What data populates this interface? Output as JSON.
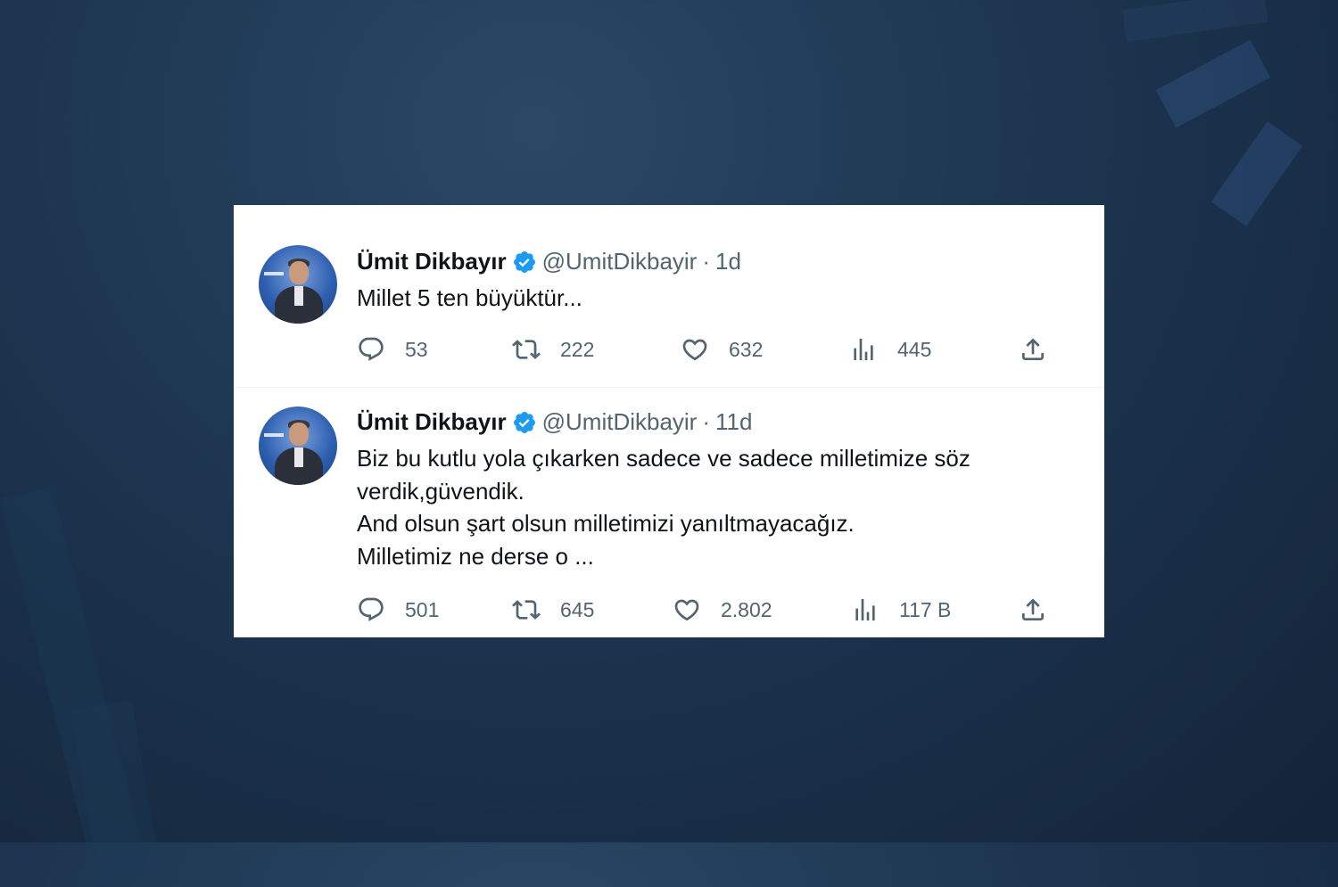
{
  "tweets": [
    {
      "name": "Ümit Dikbayır",
      "handle": "@UmitDikbayir",
      "separator": "·",
      "time": "1d",
      "lines": [
        "Millet 5 ten büyüktür..."
      ],
      "replies": "53",
      "retweets": "222",
      "likes": "632",
      "views": "445"
    },
    {
      "name": "Ümit Dikbayır",
      "handle": "@UmitDikbayir",
      "separator": "·",
      "time": "11d",
      "lines": [
        "Biz bu kutlu yola çıkarken sadece ve sadece milletimize söz",
        "verdik,güvendik.",
        "And olsun şart olsun milletimizi yanıltmayacağız.",
        "Milletimiz ne derse o ..."
      ],
      "replies": "501",
      "retweets": "645",
      "likes": "2.802",
      "views": "117 B"
    }
  ],
  "icons": {
    "verified": "verified-badge-icon",
    "reply": "reply-icon",
    "retweet": "retweet-icon",
    "like": "heart-icon",
    "views": "views-icon",
    "share": "share-icon"
  },
  "colors": {
    "verified": "#1d9bf0",
    "meta_text": "#536471",
    "body_text": "#0f1419",
    "card_background": "#ffffff"
  }
}
